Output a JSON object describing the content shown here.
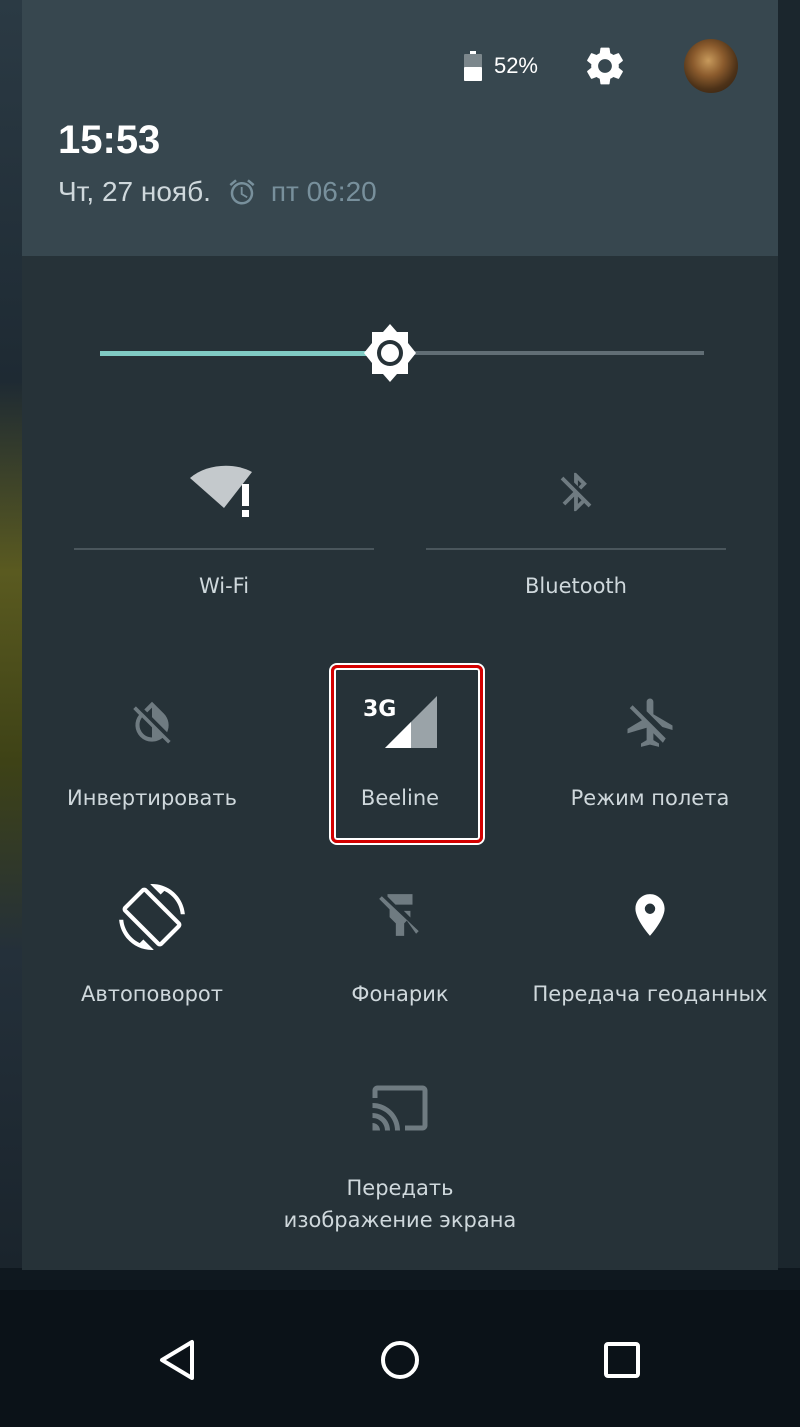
{
  "status": {
    "battery_level": "52%",
    "icons": [
      "battery-icon",
      "settings-gear-icon",
      "user-avatar"
    ]
  },
  "header": {
    "time": "15:53",
    "date": "Чт, 27 нояб.",
    "alarm_icon": "alarm-clock-icon",
    "alarm_time": "пт 06:20"
  },
  "brightness": {
    "level": 0.48,
    "icon": "brightness-sun-icon"
  },
  "tiles": {
    "wifi": {
      "label": "Wi-Fi",
      "icon": "wifi-alert-icon"
    },
    "bluetooth": {
      "label": "Bluetooth",
      "icon": "bluetooth-off-icon"
    },
    "invert": {
      "label": "Инвертировать",
      "icon": "invert-colors-off-icon"
    },
    "mobile": {
      "label": "Beeline",
      "network_type": "3G",
      "icon": "cellular-signal-icon"
    },
    "airplane": {
      "label": "Режим полета",
      "icon": "airplane-off-icon"
    },
    "rotate": {
      "label": "Автоповорот",
      "icon": "screen-rotation-icon"
    },
    "flashlight": {
      "label": "Фонарик",
      "icon": "flashlight-off-icon"
    },
    "location": {
      "label": "Передача геоданных",
      "icon": "location-pin-icon"
    },
    "cast": {
      "label_line1": "Передать",
      "label_line2": "изображение экрана",
      "icon": "cast-icon"
    }
  },
  "navbar": {
    "icons": [
      "back-icon",
      "home-icon",
      "recents-icon"
    ]
  },
  "colors": {
    "panel": "#263238",
    "header": "#37474f",
    "accent": "#80cbc4",
    "highlight": "#d40000"
  }
}
